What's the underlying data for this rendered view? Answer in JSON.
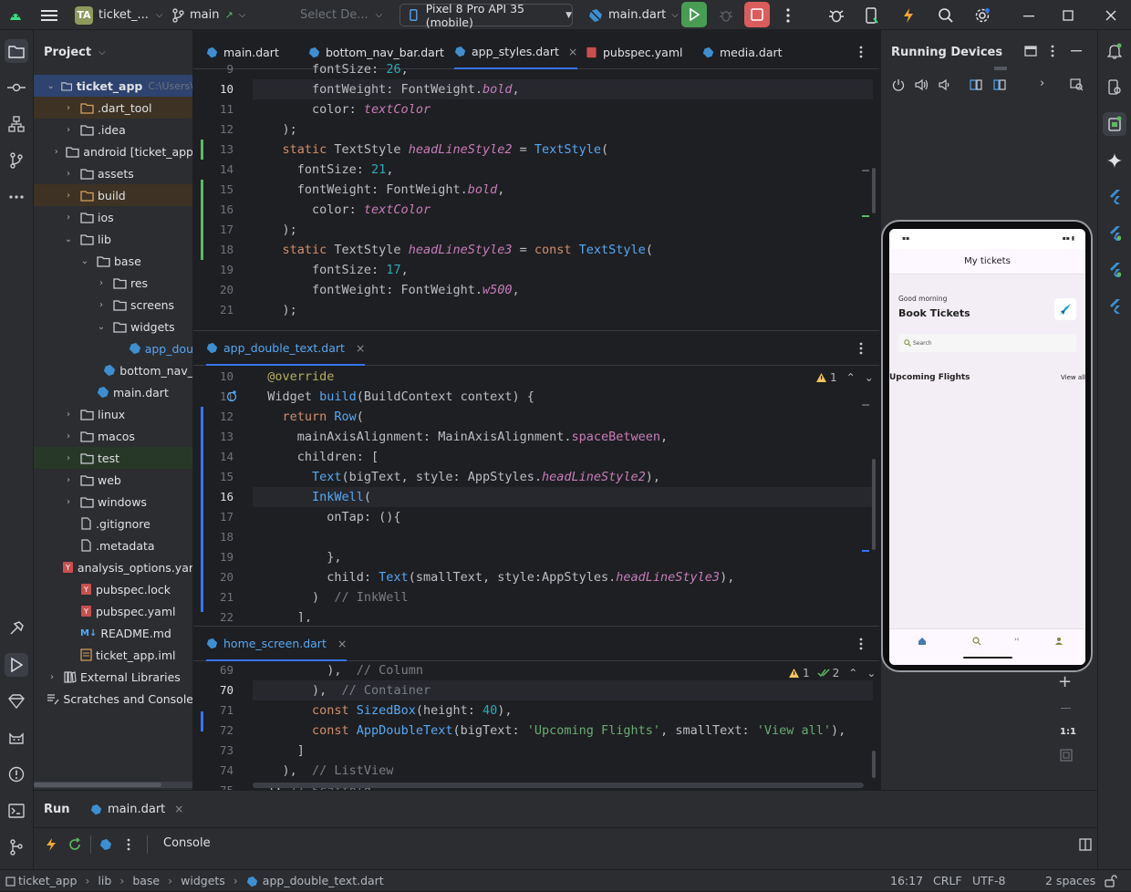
{
  "titlebar": {
    "project_badge": "TA",
    "project_name": "ticket_...",
    "branch": "main",
    "config_placeholder": "Select De...",
    "device": "Pixel 8 Pro API 35 (mobile)",
    "run_config": "main.dart"
  },
  "project_panel": {
    "title": "Project",
    "root": "ticket_app",
    "root_path": "C:\\Users\\",
    "items": [
      {
        "label": ".dart_tool",
        "depth": 1,
        "type": "folder",
        "expanded": false,
        "excluded": true
      },
      {
        "label": ".idea",
        "depth": 1,
        "type": "folder",
        "expanded": false,
        "excluded": false
      },
      {
        "label": "android [ticket_app",
        "depth": 1,
        "type": "folder",
        "expanded": false,
        "excluded": false
      },
      {
        "label": "assets",
        "depth": 1,
        "type": "folder",
        "expanded": false,
        "excluded": false
      },
      {
        "label": "build",
        "depth": 1,
        "type": "folder",
        "expanded": false,
        "excluded": true
      },
      {
        "label": "ios",
        "depth": 1,
        "type": "folder",
        "expanded": false,
        "excluded": false
      },
      {
        "label": "lib",
        "depth": 1,
        "type": "folder",
        "expanded": true,
        "excluded": false
      },
      {
        "label": "base",
        "depth": 2,
        "type": "folder",
        "expanded": true,
        "excluded": false
      },
      {
        "label": "res",
        "depth": 3,
        "type": "folder",
        "expanded": false,
        "excluded": false
      },
      {
        "label": "screens",
        "depth": 3,
        "type": "folder",
        "expanded": false,
        "excluded": false
      },
      {
        "label": "widgets",
        "depth": 3,
        "type": "folder",
        "expanded": true,
        "excluded": false
      },
      {
        "label": "app_dou",
        "depth": 4,
        "type": "dart",
        "expanded": false,
        "excluded": false
      },
      {
        "label": "bottom_nav_",
        "depth": 3,
        "type": "dart",
        "expanded": false,
        "excluded": false
      },
      {
        "label": "main.dart",
        "depth": 2,
        "type": "dart",
        "expanded": false,
        "excluded": false
      },
      {
        "label": "linux",
        "depth": 1,
        "type": "folder",
        "expanded": false,
        "excluded": false
      },
      {
        "label": "macos",
        "depth": 1,
        "type": "folder",
        "expanded": false,
        "excluded": false
      },
      {
        "label": "test",
        "depth": 1,
        "type": "folder",
        "expanded": false,
        "excluded": false,
        "highlight": true
      },
      {
        "label": "web",
        "depth": 1,
        "type": "folder",
        "expanded": false,
        "excluded": false
      },
      {
        "label": "windows",
        "depth": 1,
        "type": "folder",
        "expanded": false,
        "excluded": false
      },
      {
        "label": ".gitignore",
        "depth": 1,
        "type": "file",
        "expanded": false,
        "excluded": false
      },
      {
        "label": ".metadata",
        "depth": 1,
        "type": "file",
        "expanded": false,
        "excluded": false
      },
      {
        "label": "analysis_options.yar",
        "depth": 1,
        "type": "yaml",
        "expanded": false,
        "excluded": false
      },
      {
        "label": "pubspec.lock",
        "depth": 1,
        "type": "yaml",
        "expanded": false,
        "excluded": false
      },
      {
        "label": "pubspec.yaml",
        "depth": 1,
        "type": "yaml",
        "expanded": false,
        "excluded": false
      },
      {
        "label": "README.md",
        "depth": 1,
        "type": "md",
        "expanded": false,
        "excluded": false
      },
      {
        "label": "ticket_app.iml",
        "depth": 1,
        "type": "iml",
        "expanded": false,
        "excluded": false
      },
      {
        "label": "External Libraries",
        "depth": 0,
        "type": "lib",
        "expanded": false,
        "excluded": false
      },
      {
        "label": "Scratches and Console",
        "depth": 0,
        "type": "scratch",
        "expanded": false,
        "excluded": false
      }
    ]
  },
  "editor1": {
    "tabs": [
      "main.dart",
      "bottom_nav_bar.dart",
      "app_styles.dart",
      "pubspec.yaml",
      "media.dart"
    ],
    "active_tab": 2,
    "lines": [
      {
        "num": "9",
        "segs": [
          {
            "c": "t",
            "s": "        fontSize: "
          },
          {
            "c": "n",
            "s": "26"
          },
          {
            "c": "t",
            "s": ","
          }
        ]
      },
      {
        "num": "10",
        "segs": [
          {
            "c": "t",
            "s": "        fontWeight: FontWeight."
          },
          {
            "c": "p",
            "s": "bold"
          },
          {
            "c": "t",
            "s": ","
          }
        ]
      },
      {
        "num": "11",
        "segs": [
          {
            "c": "t",
            "s": "        color: "
          },
          {
            "c": "p",
            "s": "textColor"
          }
        ]
      },
      {
        "num": "12",
        "segs": [
          {
            "c": "t",
            "s": "    );"
          }
        ]
      },
      {
        "num": "13",
        "segs": [
          {
            "c": "k",
            "s": "    static "
          },
          {
            "c": "t",
            "s": "TextStyle "
          },
          {
            "c": "p",
            "s": "headLineStyle2"
          },
          {
            "c": "t",
            "s": " = "
          },
          {
            "c": "f",
            "s": "TextStyle"
          },
          {
            "c": "t",
            "s": "("
          }
        ]
      },
      {
        "num": "14",
        "segs": [
          {
            "c": "t",
            "s": "      fontSize: "
          },
          {
            "c": "n",
            "s": "21"
          },
          {
            "c": "t",
            "s": ","
          }
        ]
      },
      {
        "num": "15",
        "segs": [
          {
            "c": "t",
            "s": "      fontWeight: FontWeight."
          },
          {
            "c": "p",
            "s": "bold"
          },
          {
            "c": "t",
            "s": ","
          }
        ]
      },
      {
        "num": "16",
        "segs": [
          {
            "c": "t",
            "s": "        color: "
          },
          {
            "c": "p",
            "s": "textColor"
          }
        ]
      },
      {
        "num": "17",
        "segs": [
          {
            "c": "t",
            "s": "    );"
          }
        ]
      },
      {
        "num": "18",
        "segs": [
          {
            "c": "k",
            "s": "    static "
          },
          {
            "c": "t",
            "s": "TextStyle "
          },
          {
            "c": "p",
            "s": "headLineStyle3"
          },
          {
            "c": "t",
            "s": " = "
          },
          {
            "c": "k",
            "s": "const "
          },
          {
            "c": "f",
            "s": "TextStyle"
          },
          {
            "c": "t",
            "s": "("
          }
        ]
      },
      {
        "num": "19",
        "segs": [
          {
            "c": "t",
            "s": "        fontSize: "
          },
          {
            "c": "n",
            "s": "17"
          },
          {
            "c": "t",
            "s": ","
          }
        ]
      },
      {
        "num": "20",
        "segs": [
          {
            "c": "t",
            "s": "        fontWeight: FontWeight."
          },
          {
            "c": "p",
            "s": "w500"
          },
          {
            "c": "t",
            "s": ","
          }
        ]
      },
      {
        "num": "21",
        "segs": [
          {
            "c": "t",
            "s": "    );"
          }
        ]
      }
    ]
  },
  "editor2": {
    "tabs": [
      "app_double_text.dart"
    ],
    "warning_count": "1",
    "lines": [
      {
        "num": "10",
        "segs": [
          {
            "c": "an",
            "s": "  @override"
          }
        ]
      },
      {
        "num": "11",
        "segs": [
          {
            "c": "t",
            "s": "  Widget "
          },
          {
            "c": "f",
            "s": "build"
          },
          {
            "c": "t",
            "s": "(BuildContext context) {"
          }
        ]
      },
      {
        "num": "12",
        "segs": [
          {
            "c": "k",
            "s": "    return "
          },
          {
            "c": "f",
            "s": "Row"
          },
          {
            "c": "t",
            "s": "("
          }
        ]
      },
      {
        "num": "13",
        "segs": [
          {
            "c": "t",
            "s": "      mainAxisAlignment: MainAxisAlignment."
          },
          {
            "c": "m",
            "s": "spaceBetween"
          },
          {
            "c": "t",
            "s": ","
          }
        ]
      },
      {
        "num": "14",
        "segs": [
          {
            "c": "t",
            "s": "      children: ["
          }
        ]
      },
      {
        "num": "15",
        "segs": [
          {
            "c": "f",
            "s": "        Text"
          },
          {
            "c": "t",
            "s": "(bigText, style: AppStyles."
          },
          {
            "c": "p",
            "s": "headLineStyle2"
          },
          {
            "c": "t",
            "s": "),"
          }
        ]
      },
      {
        "num": "16",
        "segs": [
          {
            "c": "f",
            "s": "        InkWell"
          },
          {
            "c": "t",
            "s": "("
          }
        ]
      },
      {
        "num": "17",
        "segs": [
          {
            "c": "t",
            "s": "          onTap: (){"
          }
        ]
      },
      {
        "num": "18",
        "segs": [
          {
            "c": "t",
            "s": ""
          }
        ]
      },
      {
        "num": "19",
        "segs": [
          {
            "c": "t",
            "s": "          },"
          }
        ]
      },
      {
        "num": "20",
        "segs": [
          {
            "c": "t",
            "s": "          child: "
          },
          {
            "c": "f",
            "s": "Text"
          },
          {
            "c": "t",
            "s": "(smallText, style:AppStyles."
          },
          {
            "c": "p",
            "s": "headLineStyle3"
          },
          {
            "c": "t",
            "s": "),"
          }
        ]
      },
      {
        "num": "21",
        "segs": [
          {
            "c": "t",
            "s": "        )  "
          },
          {
            "c": "c",
            "s": "// InkWell"
          }
        ]
      },
      {
        "num": "22",
        "segs": [
          {
            "c": "t",
            "s": "      ],"
          }
        ]
      }
    ]
  },
  "editor3": {
    "tabs": [
      "home_screen.dart"
    ],
    "warning_count": "1",
    "ok_count": "2",
    "lines": [
      {
        "num": "69",
        "segs": [
          {
            "c": "t",
            "s": "          ),  "
          },
          {
            "c": "c",
            "s": "// Column"
          }
        ]
      },
      {
        "num": "70",
        "segs": [
          {
            "c": "t",
            "s": "        ),  "
          },
          {
            "c": "c",
            "s": "// Container"
          }
        ]
      },
      {
        "num": "71",
        "segs": [
          {
            "c": "k",
            "s": "        const "
          },
          {
            "c": "f",
            "s": "SizedBox"
          },
          {
            "c": "t",
            "s": "(height: "
          },
          {
            "c": "n",
            "s": "40"
          },
          {
            "c": "t",
            "s": "),"
          }
        ]
      },
      {
        "num": "72",
        "segs": [
          {
            "c": "k",
            "s": "        const "
          },
          {
            "c": "f",
            "s": "AppDoubleText"
          },
          {
            "c": "t",
            "s": "(bigText: "
          },
          {
            "c": "s",
            "s": "'Upcoming Flights'"
          },
          {
            "c": "t",
            "s": ", smallText: "
          },
          {
            "c": "s",
            "s": "'View all'"
          },
          {
            "c": "t",
            "s": "),"
          }
        ]
      },
      {
        "num": "73",
        "segs": [
          {
            "c": "t",
            "s": "      ]"
          }
        ]
      },
      {
        "num": "74",
        "segs": [
          {
            "c": "t",
            "s": "    ),  "
          },
          {
            "c": "c",
            "s": "// ListView"
          }
        ]
      },
      {
        "num": "75",
        "segs": [
          {
            "c": "t",
            "s": "  ); "
          },
          {
            "c": "c",
            "s": "// Scaffold"
          }
        ]
      }
    ]
  },
  "running_devices": {
    "title": "Running Devices",
    "phone": {
      "app_title": "My tickets",
      "greeting": "Good morning",
      "headline": "Book Tickets",
      "search_placeholder": "Search",
      "upcoming": "Upcoming Flights",
      "view_all": "View all"
    },
    "zoom_label": "1:1"
  },
  "run_panel": {
    "tab_run": "Run",
    "tab_main": "main.dart",
    "console": "Console"
  },
  "statusbar": {
    "breadcrumb": [
      "ticket_app",
      "lib",
      "base",
      "widgets",
      "app_double_text.dart"
    ],
    "position": "16:17",
    "line_sep": "CRLF",
    "encoding": "UTF-8",
    "indent": "2 spaces"
  },
  "colors": {
    "bg": "#1e1f22",
    "panel": "#2b2d30",
    "accent": "#3574f0",
    "run_green": "#499c54",
    "stop_red": "#db5c5c",
    "dart_blue": "#3d8fd1"
  }
}
